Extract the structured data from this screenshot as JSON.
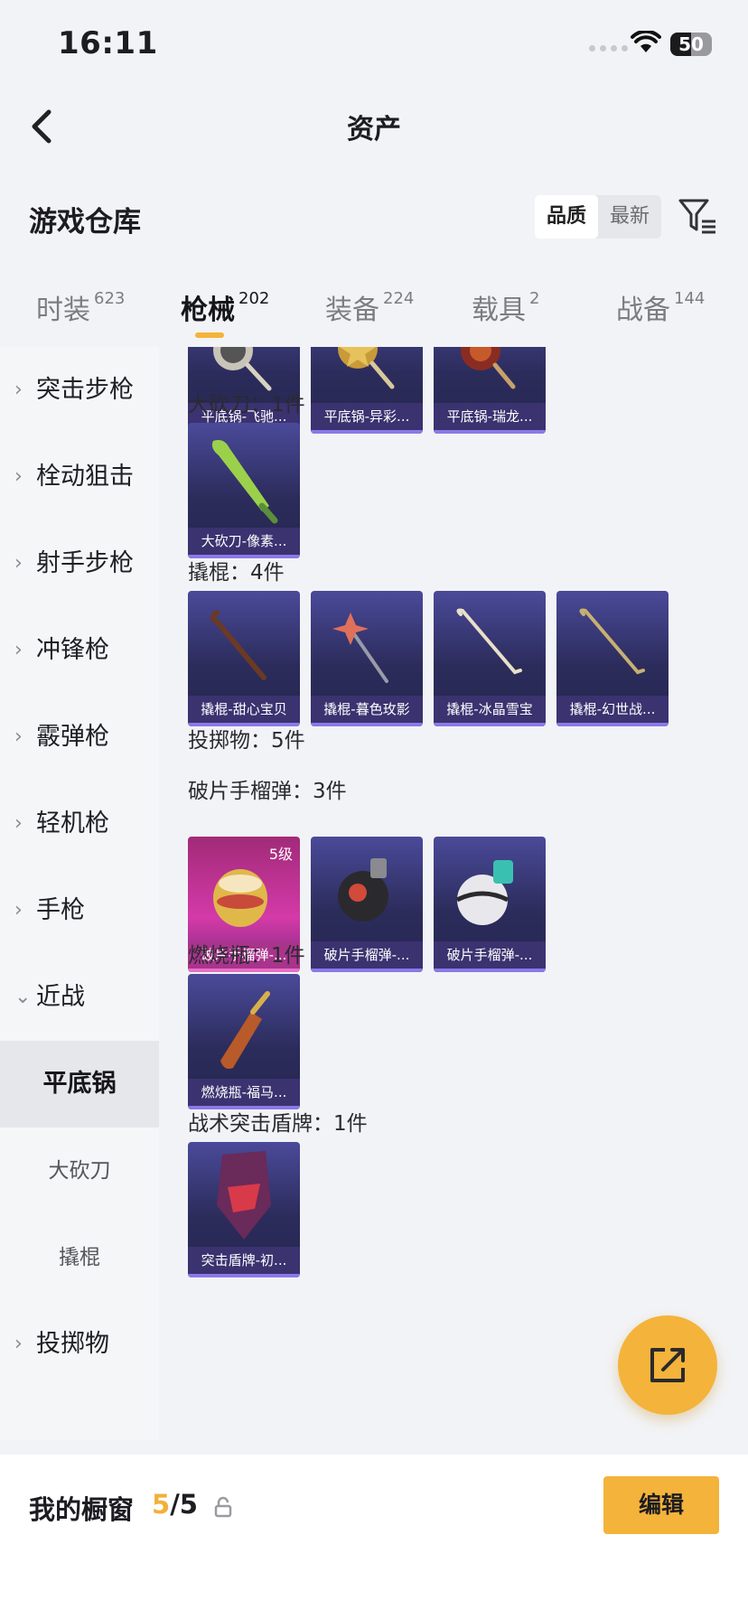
{
  "status_bar": {
    "time": "16:11",
    "battery": 50
  },
  "nav": {
    "title": "资产"
  },
  "warehouse": {
    "title": "游戏仓库",
    "sort_options": [
      "品质",
      "最新"
    ]
  },
  "tabs": [
    {
      "label": "时装",
      "count": "623"
    },
    {
      "label": "枪械",
      "count": "202"
    },
    {
      "label": "装备",
      "count": "224"
    },
    {
      "label": "载具",
      "count": "2"
    },
    {
      "label": "战备",
      "count": "144"
    }
  ],
  "sidebar": {
    "categories": [
      "突击步枪",
      "栓动狙击",
      "射手步枪",
      "冲锋枪",
      "霰弹枪",
      "轻机枪",
      "手枪",
      "近战"
    ],
    "melee_sub": [
      "平底锅",
      "大砍刀",
      "撬棍"
    ],
    "last_category": "投掷物"
  },
  "content": {
    "pan_items": [
      "平底锅-飞驰...",
      "平底锅-异彩...",
      "平底锅-瑞龙..."
    ],
    "machete_header": "大砍刀：1件",
    "machete_items": [
      "大砍刀-像素..."
    ],
    "crowbar_header": "撬棍：4件",
    "crowbar_items": [
      "撬棍-甜心宝贝",
      "撬棍-暮色玫影",
      "撬棍-冰晶雪宝",
      "撬棍-幻世战..."
    ],
    "throwable_header": "投掷物：5件",
    "frag_header": "破片手榴弹：3件",
    "frag_items": [
      {
        "name": "破片手榴弹-...",
        "level": "5级"
      },
      {
        "name": "破片手榴弹-..."
      },
      {
        "name": "破片手榴弹-..."
      }
    ],
    "molotov_header": "燃烧瓶：1件",
    "molotov_items": [
      "燃烧瓶-福马..."
    ],
    "shield_header": "战术突击盾牌：1件",
    "shield_items": [
      "突击盾牌-初..."
    ]
  },
  "footer": {
    "label": "我的橱窗",
    "current": "5",
    "total": "/5",
    "edit": "编辑"
  },
  "colors": {
    "accent": "#f4b33a",
    "card_purple": "#2c2c5c",
    "card_pink": "#d43aa8"
  }
}
